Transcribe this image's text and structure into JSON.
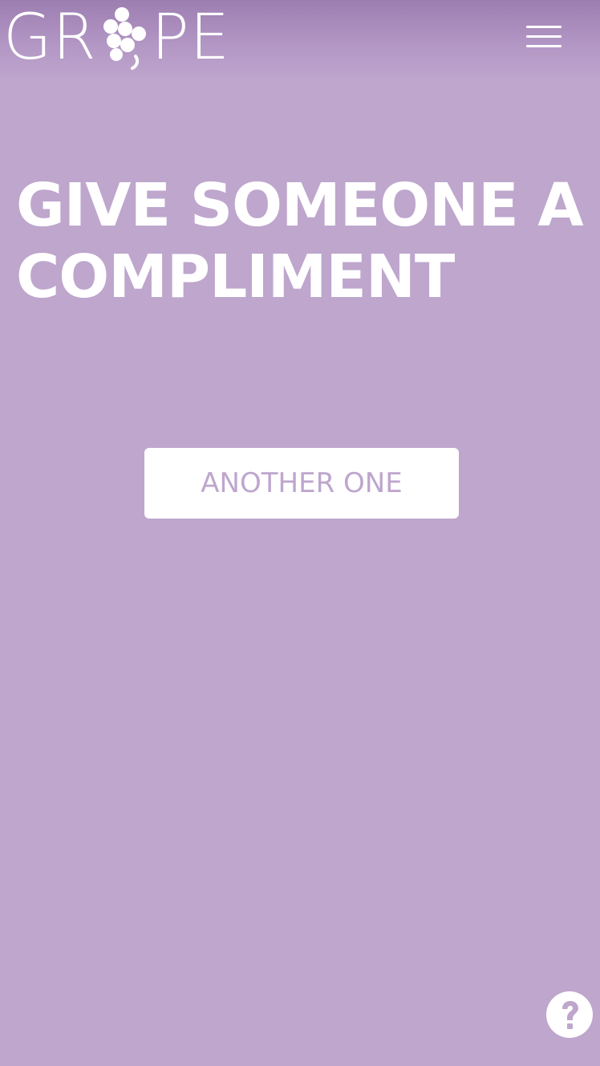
{
  "header": {
    "logo": {
      "text_left": "GR",
      "text_right": "PE",
      "mark_icon": "grape-cluster-icon"
    },
    "menu_icon": "hamburger-menu-icon"
  },
  "main": {
    "headline": "GIVE SOMEONE A COMPLIMENT",
    "another_button_label": "ANOTHER ONE"
  },
  "help": {
    "icon": "question-circle-icon"
  },
  "colors": {
    "background": "#bea6cd",
    "header_gradient_top": "#9c7eb1",
    "foreground": "#ffffff",
    "button_text": "#bea6cd"
  }
}
